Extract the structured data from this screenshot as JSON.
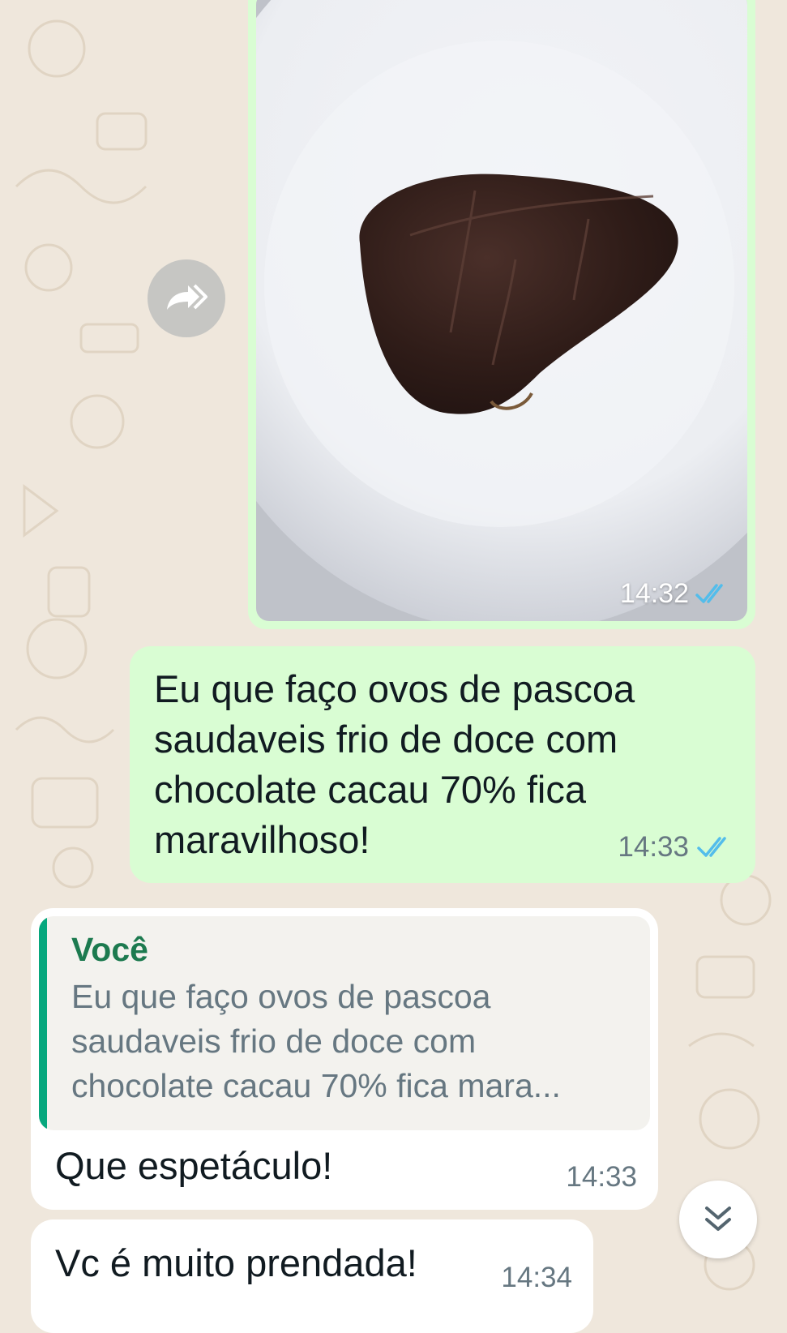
{
  "colors": {
    "outgoing_bubble": "#d9fdd3",
    "incoming_bubble": "#ffffff",
    "read_ticks": "#53bdeb",
    "quote_accent": "#06a77d",
    "quote_author": "#1c7a4f",
    "wallpaper": "#efe7dc"
  },
  "icons": {
    "forward": "forward-icon",
    "read_receipt": "double-check-icon",
    "scroll_down": "chevron-double-down-icon"
  },
  "image_message": {
    "time": "14:32"
  },
  "outgoing_text": {
    "text": "Eu que faço ovos de pascoa\nsaudaveis frio de doce com\nchocolate cacau 70% fica\nmaravilhoso!",
    "time": "14:33"
  },
  "incoming_reply": {
    "quote_author": "Você",
    "quote_text": "Eu que faço ovos de pascoa\nsaudaveis frio de doce com\nchocolate cacau 70% fica mara...",
    "text": "Que espetáculo!",
    "time": "14:33"
  },
  "incoming_second": {
    "text": "Vc é muito prendada!",
    "time": "14:34"
  }
}
